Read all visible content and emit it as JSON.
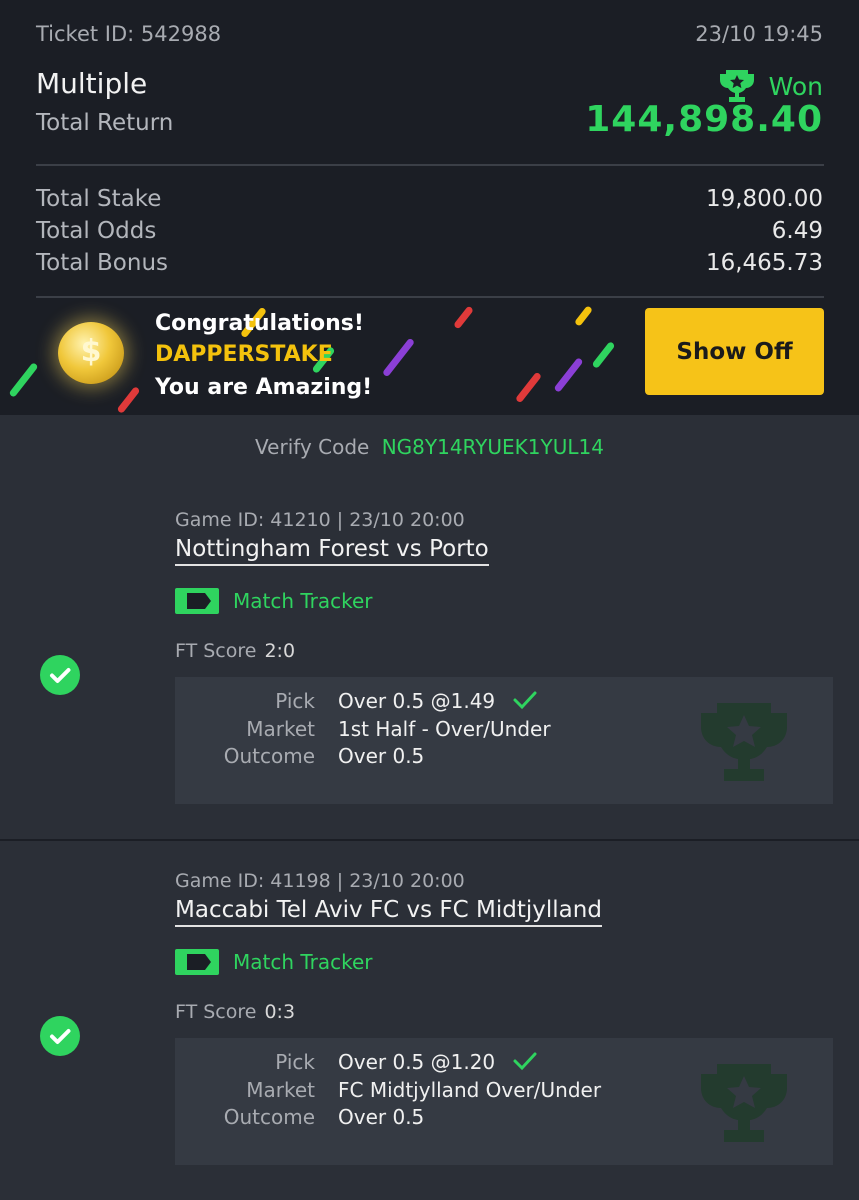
{
  "header": {
    "ticket_id": "Ticket ID: 542988",
    "date": "23/10 19:45",
    "bet_type": "Multiple",
    "total_return_label": "Total Return",
    "status": "Won",
    "total_return_value": "144,898.40"
  },
  "totals": {
    "stake_label": "Total Stake",
    "stake_value": "19,800.00",
    "odds_label": "Total Odds",
    "odds_value": "6.49",
    "bonus_label": "Total Bonus",
    "bonus_value": "16,465.73"
  },
  "banner": {
    "line1": "Congratulations!",
    "username": "DAPPERSTAKE",
    "line3": "You are Amazing!",
    "button": "Show Off"
  },
  "verify": {
    "label": "Verify Code",
    "code": "NG8Y14RYUEK1YUL14"
  },
  "games": [
    {
      "meta": "Game ID: 41210 | 23/10 20:00",
      "title": "Nottingham Forest vs Porto",
      "tracker": "Match Tracker",
      "ft_label": "FT Score",
      "ft_value": "2:0",
      "pick_label": "Pick",
      "pick_value": "Over 0.5 @1.49",
      "market_label": "Market",
      "market_value": "1st Half - Over/Under",
      "outcome_label": "Outcome",
      "outcome_value": "Over 0.5"
    },
    {
      "meta": "Game ID: 41198 | 23/10 20:00",
      "title": "Maccabi Tel Aviv FC vs FC Midtjylland",
      "tracker": "Match Tracker",
      "ft_label": "FT Score",
      "ft_value": "0:3",
      "pick_label": "Pick",
      "pick_value": "Over 0.5 @1.20",
      "market_label": "Market",
      "market_value": "FC Midtjylland Over/Under",
      "outcome_label": "Outcome",
      "outcome_value": "Over 0.5"
    }
  ],
  "colors": {
    "accent_green": "#2fd45f",
    "button_yellow": "#f6c318",
    "background": "#1b1e25",
    "card": "#2b2f37"
  }
}
